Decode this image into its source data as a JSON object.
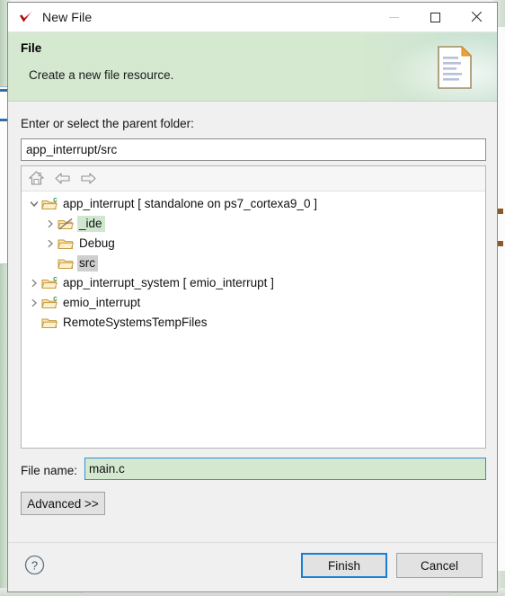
{
  "window": {
    "title": "New File",
    "icon": "red-check-icon",
    "controls": {
      "minimize": "minimize-icon",
      "maximize": "maximize-icon",
      "close": "close-icon"
    }
  },
  "header": {
    "title": "File",
    "subtitle": "Create a new file resource.",
    "graphic": "new-document-icon",
    "background_color": "#d5e8d0"
  },
  "form": {
    "parent_folder_label": "Enter or select the parent folder:",
    "parent_folder_value": "app_interrupt/src",
    "parent_folder_placeholder": "",
    "file_name_label": "File name:",
    "file_name_value": "main.c",
    "file_name_placeholder": "",
    "file_name_bg_color": "#d4e8d0",
    "file_name_border_color": "#2f8fd0",
    "advanced_label": "Advanced >>"
  },
  "tree": {
    "toolbar": [
      {
        "icon": "home-icon",
        "name": "home-button"
      },
      {
        "icon": "back-arrow-icon",
        "name": "back-button"
      },
      {
        "icon": "forward-arrow-icon",
        "name": "forward-button"
      }
    ],
    "rows": [
      {
        "label": "app_interrupt [ standalone on ps7_cortexa9_0 ]",
        "indent": 0,
        "twisty": "expanded",
        "icon": "c-project-folder-icon",
        "selection": "none"
      },
      {
        "label": "_ide",
        "indent": 1,
        "twisty": "collapsed",
        "icon": "virtual-folder-icon",
        "selection": "green"
      },
      {
        "label": "Debug",
        "indent": 1,
        "twisty": "collapsed",
        "icon": "folder-icon",
        "selection": "none"
      },
      {
        "label": "src",
        "indent": 1,
        "twisty": "none",
        "icon": "folder-icon",
        "selection": "gray"
      },
      {
        "label": "app_interrupt_system [ emio_interrupt ]",
        "indent": 0,
        "twisty": "collapsed",
        "icon": "c-project-folder-icon",
        "selection": "none"
      },
      {
        "label": "emio_interrupt",
        "indent": 0,
        "twisty": "collapsed",
        "icon": "c-project-folder-icon",
        "selection": "none"
      },
      {
        "label": "RemoteSystemsTempFiles",
        "indent": 0,
        "twisty": "none",
        "icon": "folder-icon",
        "selection": "none"
      }
    ]
  },
  "footer": {
    "help": "help-icon",
    "finish_label": "Finish",
    "cancel_label": "Cancel",
    "default_button": "Finish",
    "focus_color": "#1a7fd4"
  }
}
